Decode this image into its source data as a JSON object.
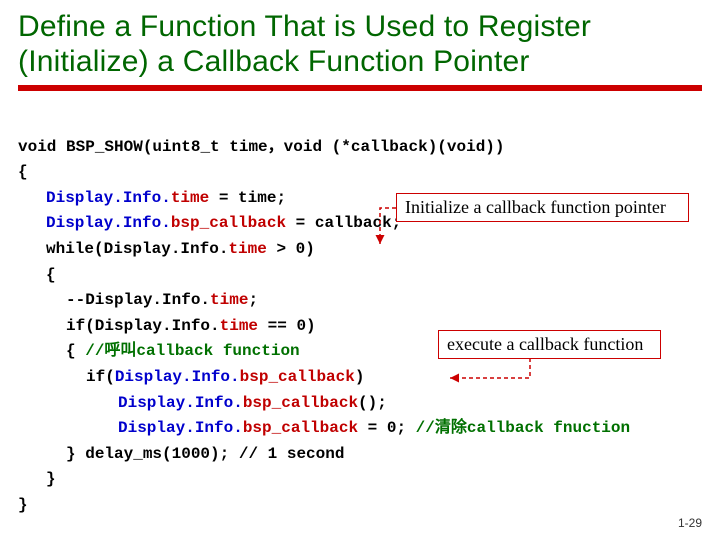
{
  "title": "Define a Function That is Used to Register (Initialize) a Callback Function Pointer",
  "code": {
    "sig_pre": "void BSP_SHOW(uint",
    "sig_8": "8",
    "sig_post1": "_t time",
    "sig_comma": "，",
    "sig_post2": "void (*callback)(void))",
    "brace_open": "{",
    "l1_a": "Display.Info.",
    "l1_b": "time",
    "l1_c": " = time;",
    "l2_a": "Display.Info.",
    "l2_b": "bsp_callback",
    "l2_c": " = callback;",
    "l3_a": "while(Display.Info.",
    "l3_b": "time",
    "l3_c": " > 0)",
    "l4": "{",
    "l5_a": "--Display.Info.",
    "l5_b": "time",
    "l5_c": ";",
    "l6_a": "if(Display.Info.",
    "l6_b": "time",
    "l6_c": " == 0)",
    "l7_a": "{",
    "l7_b": " //呼叫callback function",
    "l8_a": "if(",
    "l8_b": "Display.Info.",
    "l8_c": "bsp_callback",
    "l8_d": ")",
    "l9_a": "Display.Info.",
    "l9_b": "bsp_callback",
    "l9_c": "();",
    "l10_a": "Display.Info.",
    "l10_b": "bsp_callback",
    "l10_c": " = 0;",
    "l10_d": " //清除callback fnuction",
    "l11_a": "}",
    "l11_b": " delay_ms(1000); // 1 second",
    "l12": "}",
    "brace_close": "}"
  },
  "callouts": {
    "init": "Initialize a callback function pointer",
    "exec": "execute a callback function"
  },
  "slide_number": "1-29"
}
